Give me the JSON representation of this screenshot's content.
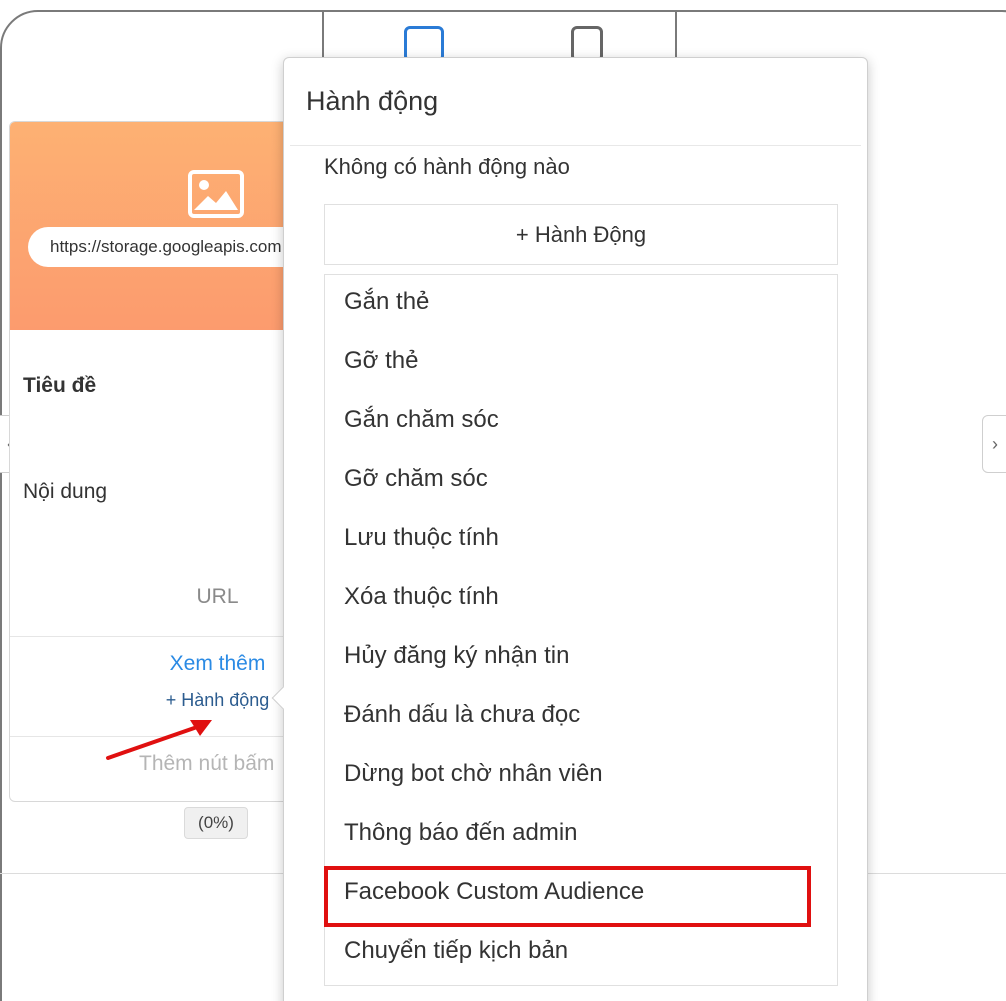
{
  "card": {
    "url_value": "https://storage.googleapis.com",
    "title": "Tiêu đề",
    "content": "Nội dung",
    "url_label": "URL",
    "see_more": "Xem thêm",
    "add_action_link": "+ Hành động",
    "add_button": "Thêm nút bấm",
    "progress": "(0%)"
  },
  "nav": {
    "prev": "‹",
    "next": "›"
  },
  "popover": {
    "title": "Hành động",
    "empty_text": "Không có hành động nào",
    "add_button": "+ Hành Động",
    "actions": [
      "Gắn thẻ",
      "Gỡ thẻ",
      "Gắn chăm sóc",
      "Gỡ chăm sóc",
      "Lưu thuộc tính",
      "Xóa thuộc tính",
      "Hủy đăng ký nhận tin",
      "Đánh dấu là chưa đọc",
      "Dừng bot chờ nhân viên",
      "Thông báo đến admin",
      "Facebook Custom Audience",
      "Chuyển tiếp kịch bản"
    ],
    "highlighted_action": "Facebook Custom Audience"
  },
  "colors": {
    "hero_gradient_top": "#fdb173",
    "hero_gradient_bottom": "#fc9b6e",
    "link_blue": "#2a8ae4",
    "highlight_red": "#e01010",
    "arrow_red": "#e01010"
  },
  "icons": {
    "hero": "image-icon",
    "arrow": "red-arrow-icon",
    "view_active": "mobile-view-icon",
    "view_other": "tablet-view-icon"
  }
}
